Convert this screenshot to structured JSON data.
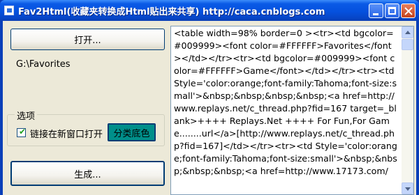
{
  "window": {
    "title": "Fav2Html(收藏夹转换成Html贴出来共享) http://caca.cnblogs.com"
  },
  "toolbar": {
    "open_label": "打开...",
    "generate_label": "生成..."
  },
  "folder_path": "G:\\Favorites",
  "options": {
    "legend": "选项",
    "new_window_label": "链接在新窗口打开",
    "new_window_checked": true,
    "category_bg_label": "分类底色",
    "category_bg_color": "#008f8a"
  },
  "output_text": "<table width=98% border=0 ><tr><td bgcolor=#009999><font color=#FFFFFF>Favorites</font></td></tr><tr><td bgcolor=#009999><font color=#FFFFFF>Game</font></td></tr><tr><td Style='color:orange;font-family:Tahoma;font-size:small'>&nbsp;&nbsp;&nbsp;&nbsp;<a href=http://www.replays.net/c_thread.php?fid=167 target=_blank>++++ Replays.Net ++++ For Fun,For Game........url</a>[http://www.replays.net/c_thread.php?fid=167]</td></tr><tr><td Style='color:orange;font-family:Tahoma;font-size:small'>&nbsp;&nbsp;&nbsp;&nbsp;<a href=http://www.17173.com/",
  "colors": {
    "titlebar": "#0a5ae6",
    "window_bg": "#ece9d8"
  },
  "icons": {
    "app": "app-icon",
    "minimize": "minimize-icon",
    "maximize": "maximize-icon",
    "close": "close-icon",
    "check": "checkmark-icon",
    "scroll_up": "scroll-up-arrow-icon",
    "scroll_down": "scroll-down-arrow-icon"
  }
}
